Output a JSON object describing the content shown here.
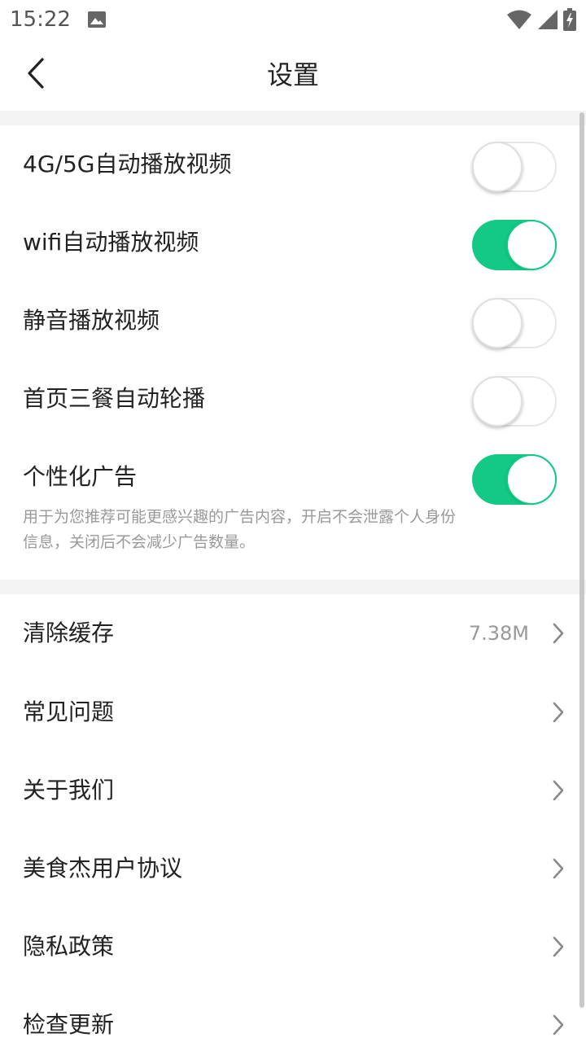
{
  "status_bar": {
    "time": "15:22",
    "icons": [
      "image-icon",
      "wifi-icon",
      "signal-icon",
      "battery-charging-icon"
    ]
  },
  "header": {
    "title": "设置",
    "back_icon": "chevron-left-icon"
  },
  "toggles": [
    {
      "label": "4G/5G自动播放视频",
      "on": false
    },
    {
      "label": "wifi自动播放视频",
      "on": true
    },
    {
      "label": "静音播放视频",
      "on": false
    },
    {
      "label": "首页三餐自动轮播",
      "on": false
    },
    {
      "label": "个性化广告",
      "on": true,
      "description": "用于为您推荐可能更感兴趣的广告内容，开启不会泄露个人身份信息，关闭后不会减少广告数量。"
    }
  ],
  "menu": [
    {
      "label": "清除缓存",
      "value": "7.38M"
    },
    {
      "label": "常见问题"
    },
    {
      "label": "关于我们"
    },
    {
      "label": "美食杰用户协议"
    },
    {
      "label": "隐私政策"
    },
    {
      "label": "检查更新"
    }
  ],
  "colors": {
    "accent": "#13c985",
    "section_bg": "#f4f4f4",
    "text_primary": "#222222",
    "text_secondary": "#999999"
  }
}
